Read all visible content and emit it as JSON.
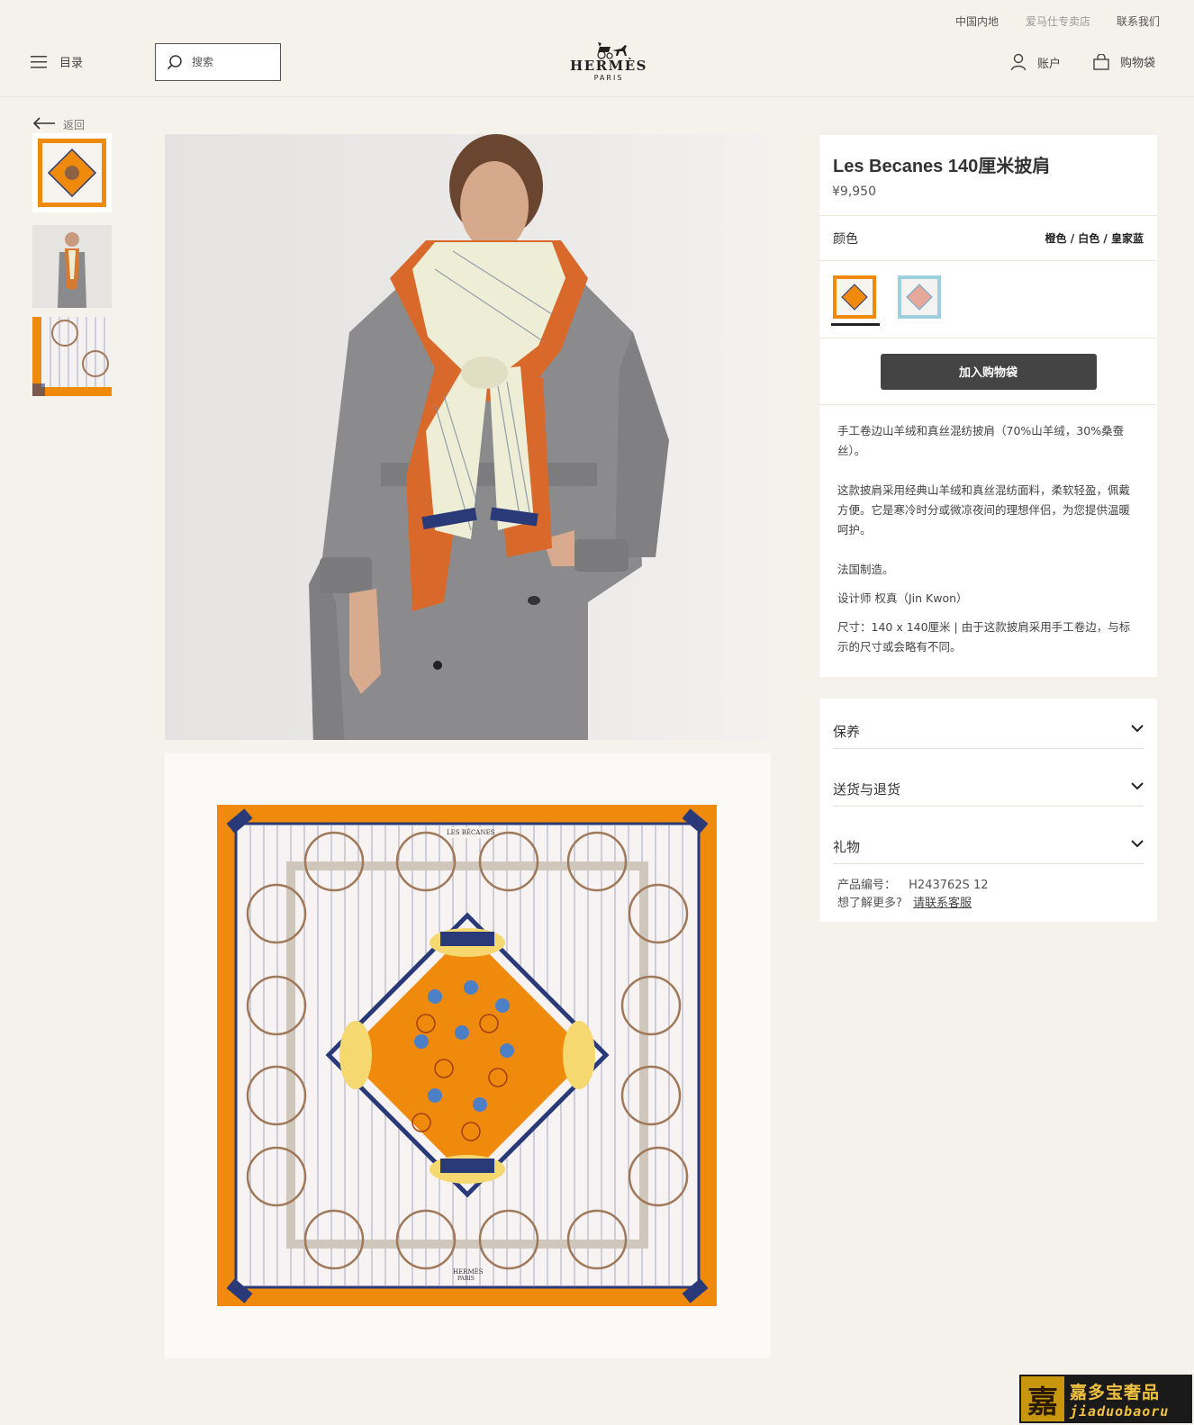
{
  "util_bar": {
    "region": "中国内地",
    "store": "爱马仕专卖店",
    "contact": "联系我们"
  },
  "header": {
    "menu_label": "目录",
    "search_placeholder": "搜索",
    "logo_brand": "HERMÈS",
    "logo_city": "PARIS",
    "account_label": "账户",
    "bag_label": "购物袋"
  },
  "back_label": "返回",
  "thumbnails": [
    {
      "name": "scarf-flat"
    },
    {
      "name": "model-wearing"
    },
    {
      "name": "scarf-detail"
    }
  ],
  "product": {
    "title": "Les Becanes 140厘米披肩",
    "price": "¥9,950",
    "color_label": "颜色",
    "color_value": "橙色 / 白色 / 皇家蓝",
    "add_to_cart": "加入购物袋",
    "desc_1": "手工卷边山羊绒和真丝混纺披肩（70%山羊绒，30%桑蚕丝）。",
    "desc_2": "这款披肩采用经典山羊绒和真丝混纺面料，柔软轻盈，佩戴方便。它是寒冷时分或微凉夜间的理想伴侣，为您提供温暖呵护。",
    "desc_3": "法国制造。",
    "desc_4": "设计师 权真（Jin Kwon）",
    "desc_5": "尺寸：140 x 140厘米 | 由于这款披肩采用手工卷边，与标示的尺寸或会略有不同。"
  },
  "accordion": [
    {
      "label": "保养"
    },
    {
      "label": "送货与退货"
    },
    {
      "label": "礼物"
    }
  ],
  "meta": {
    "sku_label": "产品编号：",
    "sku_value": "H243762S 12",
    "more_label": "想了解更多?",
    "more_link": "请联系客服"
  },
  "scarf_text": {
    "top_label": "LES BÉCANES",
    "bottom_brand": "HERMÈS",
    "bottom_city": "PARIS"
  },
  "watermark": {
    "seal": "嘉",
    "cn": "嘉多宝奢品",
    "en": "jiaduobaoru"
  },
  "colors": {
    "orange": "#f08a0c",
    "navy": "#2a3a78",
    "coat_grey": "#8a8a8c",
    "background": "#f5f1eb"
  }
}
